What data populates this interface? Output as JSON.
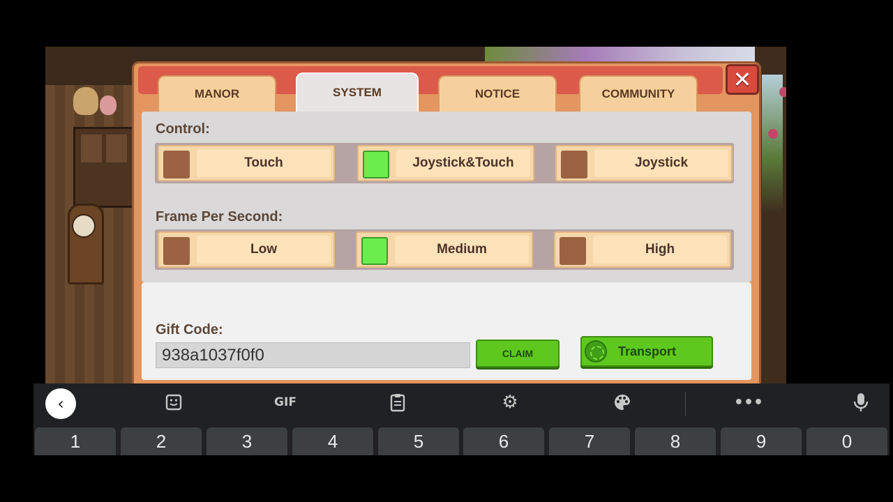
{
  "tabs": [
    {
      "label": "MANOR",
      "active": false
    },
    {
      "label": "SYSTEM",
      "active": true
    },
    {
      "label": "NOTICE",
      "active": false
    },
    {
      "label": "COMMUNITY",
      "active": false
    }
  ],
  "control": {
    "label": "Control:",
    "options": [
      {
        "label": "Touch",
        "selected": false
      },
      {
        "label": "Joystick&Touch",
        "selected": true
      },
      {
        "label": "Joystick",
        "selected": false
      }
    ]
  },
  "fps": {
    "label": "Frame Per Second:",
    "options": [
      {
        "label": "Low",
        "selected": false
      },
      {
        "label": "Medium",
        "selected": true
      },
      {
        "label": "High",
        "selected": false
      }
    ]
  },
  "gift": {
    "label": "Gift Code:",
    "value": "938a1037f0f0",
    "claim_label": "CLAIM",
    "transport_label": "Transport"
  },
  "close_icon": "close-icon",
  "colors": {
    "selected_check": "#6bed4e",
    "unselected_check": "#9a6240",
    "claim_green": "#5ec81e",
    "header_red": "#dc5a4a"
  },
  "keyboard": {
    "toolbar_icons": [
      "back-icon",
      "sticker-icon",
      "gif-icon",
      "clipboard-icon",
      "settings-icon",
      "palette-icon",
      "more-icon",
      "mic-icon"
    ],
    "gif_label": "GIF",
    "number_keys": [
      "1",
      "2",
      "3",
      "4",
      "5",
      "6",
      "7",
      "8",
      "9",
      "0"
    ]
  }
}
